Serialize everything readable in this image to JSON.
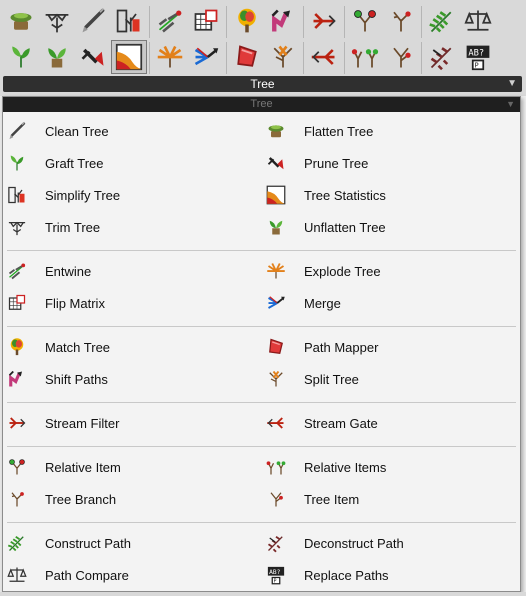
{
  "panel": {
    "title": "Tree",
    "expand_icon": "expand-arrow-icon"
  },
  "dropdown": {
    "header": "Tree",
    "expand_icon": "expand-arrow-icon"
  },
  "toolbar": {
    "row1": [
      "flatten-tree-icon",
      "trim-tree-icon",
      "clean-tree-icon",
      "simplify-tree-icon",
      "entwine-icon",
      "flip-matrix-icon",
      "match-tree-icon",
      "shift-paths-icon",
      "stream-filter-icon",
      "relative-item-icon",
      "tree-branch-icon",
      "construct-path-icon",
      "path-compare-icon"
    ],
    "row2": [
      "graft-tree-icon",
      "unflatten-tree-icon",
      "prune-tree-icon",
      "tree-statistics-icon",
      "explode-tree-icon",
      "merge-icon",
      "path-mapper-icon",
      "split-tree-icon",
      "stream-gate-icon",
      "relative-items-icon",
      "tree-item-icon",
      "deconstruct-path-icon",
      "replace-paths-icon"
    ],
    "selected": "tree-statistics-icon"
  },
  "menu": {
    "groups": [
      {
        "left": [
          {
            "label": "Clean Tree",
            "icon": "clean-tree-icon"
          },
          {
            "label": "Graft Tree",
            "icon": "graft-tree-icon"
          },
          {
            "label": "Simplify Tree",
            "icon": "simplify-tree-icon"
          },
          {
            "label": "Trim Tree",
            "icon": "trim-tree-icon"
          }
        ],
        "right": [
          {
            "label": "Flatten Tree",
            "icon": "flatten-tree-icon"
          },
          {
            "label": "Prune Tree",
            "icon": "prune-tree-icon"
          },
          {
            "label": "Tree Statistics",
            "icon": "tree-statistics-icon"
          },
          {
            "label": "Unflatten Tree",
            "icon": "unflatten-tree-icon"
          }
        ]
      },
      {
        "left": [
          {
            "label": "Entwine",
            "icon": "entwine-icon"
          },
          {
            "label": "Flip Matrix",
            "icon": "flip-matrix-icon"
          }
        ],
        "right": [
          {
            "label": "Explode Tree",
            "icon": "explode-tree-icon"
          },
          {
            "label": "Merge",
            "icon": "merge-icon"
          }
        ]
      },
      {
        "left": [
          {
            "label": "Match Tree",
            "icon": "match-tree-icon"
          },
          {
            "label": "Shift Paths",
            "icon": "shift-paths-icon"
          }
        ],
        "right": [
          {
            "label": "Path Mapper",
            "icon": "path-mapper-icon"
          },
          {
            "label": "Split Tree",
            "icon": "split-tree-icon"
          }
        ]
      },
      {
        "left": [
          {
            "label": "Stream Filter",
            "icon": "stream-filter-icon"
          }
        ],
        "right": [
          {
            "label": "Stream Gate",
            "icon": "stream-gate-icon"
          }
        ]
      },
      {
        "left": [
          {
            "label": "Relative Item",
            "icon": "relative-item-icon"
          },
          {
            "label": "Tree Branch",
            "icon": "tree-branch-icon"
          }
        ],
        "right": [
          {
            "label": "Relative Items",
            "icon": "relative-items-icon"
          },
          {
            "label": "Tree Item",
            "icon": "tree-item-icon"
          }
        ]
      },
      {
        "left": [
          {
            "label": "Construct Path",
            "icon": "construct-path-icon"
          },
          {
            "label": "Path Compare",
            "icon": "path-compare-icon"
          }
        ],
        "right": [
          {
            "label": "Deconstruct Path",
            "icon": "deconstruct-path-icon"
          },
          {
            "label": "Replace Paths",
            "icon": "replace-paths-icon"
          }
        ]
      }
    ]
  }
}
